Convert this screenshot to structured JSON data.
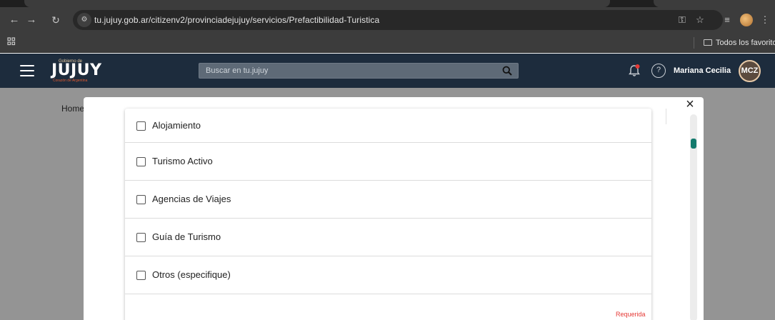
{
  "browser": {
    "url": "tu.jujuy.gob.ar/citizenv2/provinciadejujuy/servicios/Prefactibilidad-Turistica",
    "bookmarks_folder": "Todos los favoritos",
    "icons": {
      "back": "back-arrow-icon",
      "forward": "forward-arrow-icon",
      "reload": "reload-icon",
      "site_info": "tune-icon",
      "password": "key-icon",
      "star": "star-icon",
      "media": "media-control-icon",
      "menu": "kebab-menu-icon",
      "apps": "apps-grid-icon",
      "folder": "folder-icon"
    }
  },
  "header": {
    "logo_small": "Gobierno de",
    "logo": "JUJUY",
    "logo_sub": "Corazón de Argentina",
    "search_placeholder": "Buscar en tu.jujuy",
    "user_name": "Mariana Cecilia",
    "user_initials": "MCZ",
    "colors": {
      "bar": "#1d2c3d",
      "notification_dot": "#e53935"
    }
  },
  "page": {
    "breadcrumb": "Home"
  },
  "modal": {
    "close_label": "×",
    "options": [
      {
        "label": "Alojamiento",
        "checked": false
      },
      {
        "label": "Turismo Activo",
        "checked": false
      },
      {
        "label": "Agencias de Viajes",
        "checked": false
      },
      {
        "label": "Guía de Turismo",
        "checked": false
      },
      {
        "label": "Otros (especifique)",
        "checked": false
      }
    ],
    "required_text": "Requerida",
    "colors": {
      "scroll_thumb": "#137a6d",
      "required": "#e53935"
    }
  }
}
